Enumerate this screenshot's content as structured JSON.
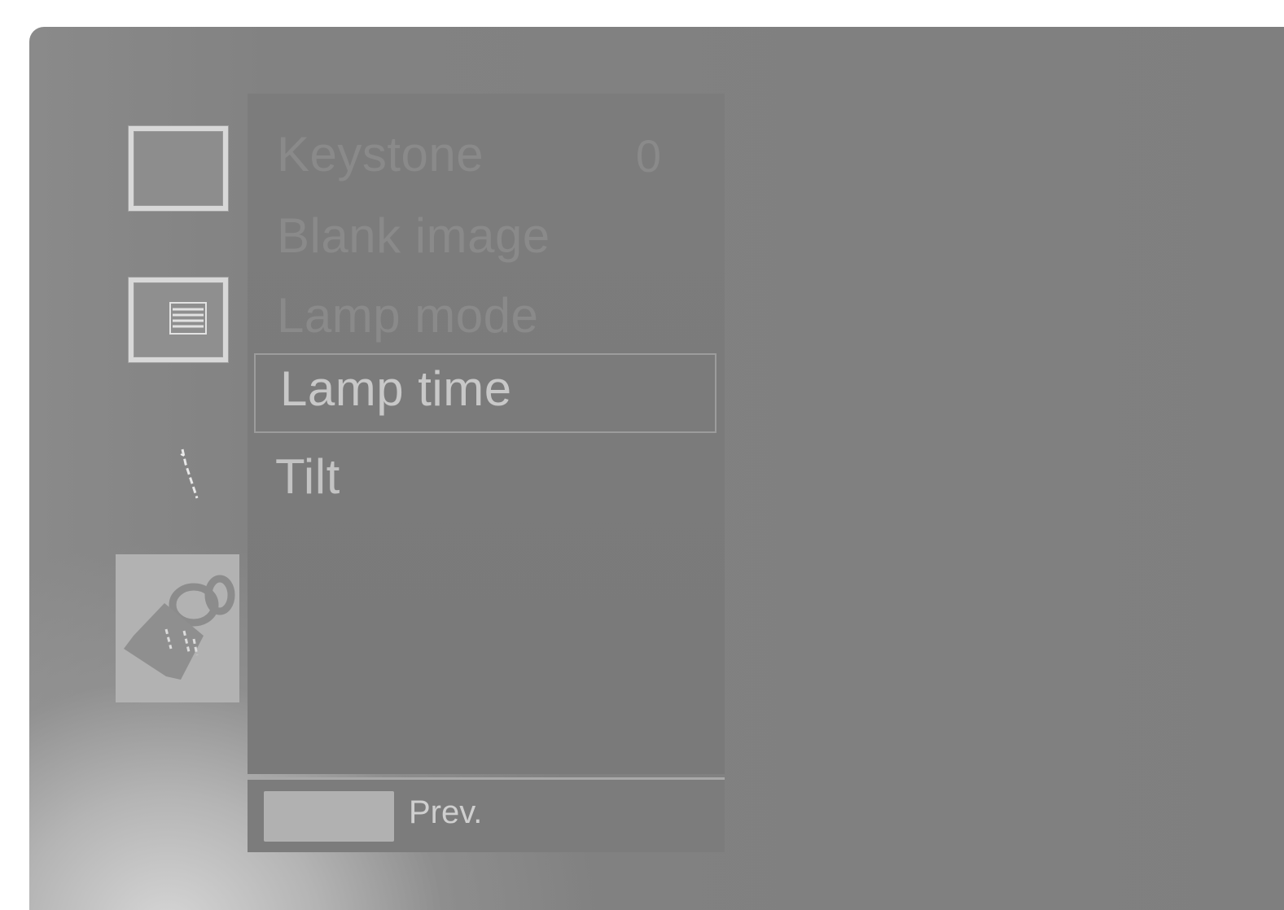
{
  "menu": {
    "items": [
      {
        "label": "Keystone",
        "value": "0"
      },
      {
        "label": "Blank image"
      },
      {
        "label": "Lamp mode"
      },
      {
        "label": "Lamp time"
      },
      {
        "label": "Tilt"
      }
    ],
    "selected_index": 3
  },
  "bottom_bar": {
    "prev_label": "Prev."
  },
  "side_icons": [
    "picture-icon",
    "menu-list-icon",
    "tool-icon",
    "special-icon"
  ],
  "colors": {
    "background": "#808080",
    "panel": "#7b7b7b",
    "active_text": "#c8c8c8",
    "dim_text": "#8a8a8a",
    "key": "#b1b1b1"
  }
}
